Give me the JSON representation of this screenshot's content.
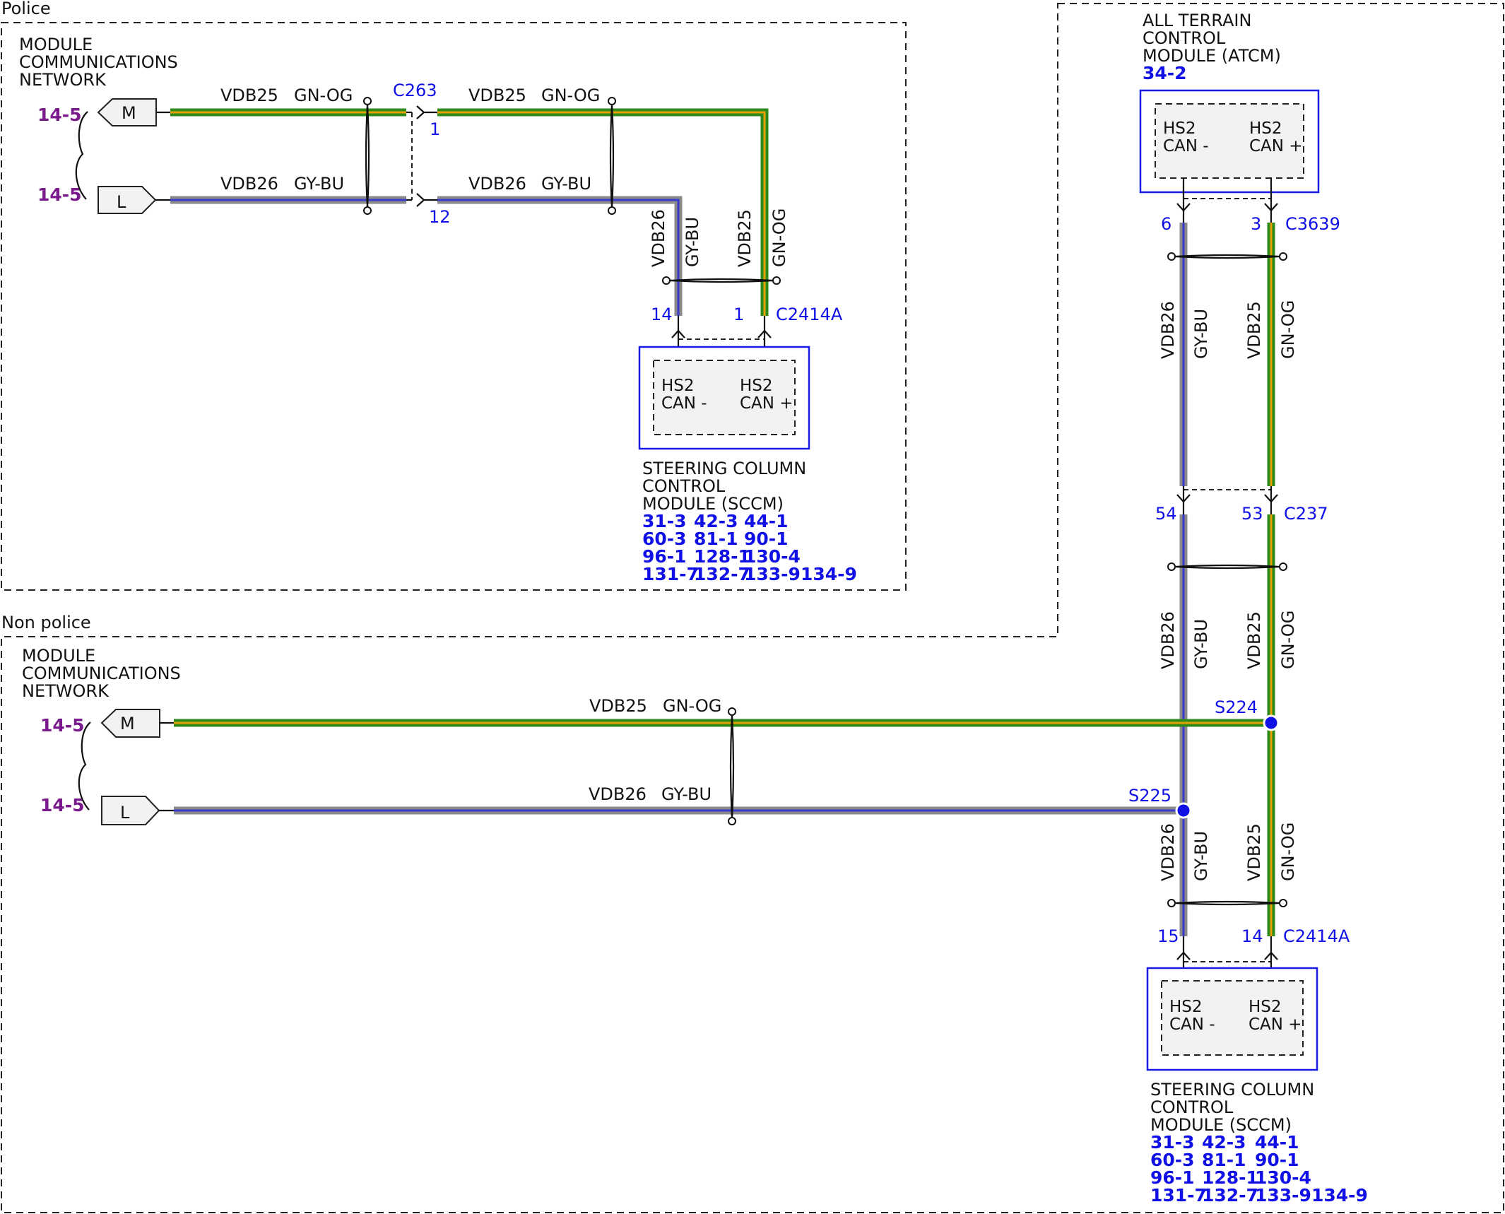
{
  "colors": {
    "gn_og_outer": "#2e8b1a",
    "gn_og_stripe": "#e5a100",
    "gy_bu_outer": "#8a8a8a",
    "gy_bu_stripe": "#3a3acd",
    "pin_blue": "#1010e6",
    "page_ref_purple": "#7a1a8c"
  },
  "police": {
    "frame_label": "Police",
    "network_title": [
      "MODULE",
      "COMMUNICATIONS",
      "NETWORK"
    ],
    "page_ref_m": "14-5",
    "page_ref_l": "14-5",
    "flag_m": "M",
    "flag_l": "L",
    "wire_upper_left": {
      "circuit": "VDB25",
      "color": "GN-OG"
    },
    "wire_lower_left": {
      "circuit": "VDB26",
      "color": "GY-BU"
    },
    "connector_c263": "C263",
    "c263_pin_upper": "1",
    "c263_pin_lower": "12",
    "wire_upper_right": {
      "circuit": "VDB25",
      "color": "GN-OG"
    },
    "wire_lower_right": {
      "circuit": "VDB26",
      "color": "GY-BU"
    },
    "vert_left": {
      "circuit": "VDB26",
      "color": "GY-BU"
    },
    "vert_right": {
      "circuit": "VDB25",
      "color": "GN-OG"
    },
    "sccm_pin_minus": "14",
    "sccm_pin_plus": "1",
    "sccm_connector": "C2414A",
    "sccm_inner_minus": [
      "HS2",
      "CAN -"
    ],
    "sccm_inner_plus": [
      "HS2",
      "CAN +"
    ],
    "sccm_name": [
      "STEERING COLUMN",
      "CONTROL",
      "MODULE (SCCM)"
    ],
    "sccm_refs": [
      [
        "31-3",
        "42-3",
        "44-1"
      ],
      [
        "60-3",
        "81-1",
        "90-1"
      ],
      [
        "96-1",
        "128-1",
        "130-4"
      ],
      [
        "131-7",
        "132-7",
        "133-9134-9"
      ]
    ]
  },
  "atcm": {
    "name": [
      "ALL TERRAIN",
      "CONTROL",
      "MODULE (ATCM)"
    ],
    "ref": "34-2",
    "inner_minus": [
      "HS2",
      "CAN -"
    ],
    "inner_plus": [
      "HS2",
      "CAN +"
    ],
    "pin_minus": "6",
    "pin_plus": "3",
    "connector": "C3639",
    "vert_left": {
      "circuit": "VDB26",
      "color": "GY-BU"
    },
    "vert_right": {
      "circuit": "VDB25",
      "color": "GN-OG"
    },
    "c237_pin_minus": "54",
    "c237_pin_plus": "53",
    "c237": "C237",
    "vert2_left": {
      "circuit": "VDB26",
      "color": "GY-BU"
    },
    "vert2_right": {
      "circuit": "VDB25",
      "color": "GN-OG"
    }
  },
  "nonpolice": {
    "frame_label": "Non police",
    "network_title": [
      "MODULE",
      "COMMUNICATIONS",
      "NETWORK"
    ],
    "page_ref_m": "14-5",
    "page_ref_l": "14-5",
    "flag_m": "M",
    "flag_l": "L",
    "wire_upper": {
      "circuit": "VDB25",
      "color": "GN-OG"
    },
    "wire_lower": {
      "circuit": "VDB26",
      "color": "GY-BU"
    },
    "splice_plus": "S224",
    "splice_minus": "S225",
    "vert_left": {
      "circuit": "VDB26",
      "color": "GY-BU"
    },
    "vert_right": {
      "circuit": "VDB25",
      "color": "GN-OG"
    },
    "sccm_pin_minus": "15",
    "sccm_pin_plus": "14",
    "sccm_connector": "C2414A",
    "sccm_inner_minus": [
      "HS2",
      "CAN -"
    ],
    "sccm_inner_plus": [
      "HS2",
      "CAN +"
    ],
    "sccm_name": [
      "STEERING COLUMN",
      "CONTROL",
      "MODULE (SCCM)"
    ],
    "sccm_refs": [
      [
        "31-3",
        "42-3",
        "44-1"
      ],
      [
        "60-3",
        "81-1",
        "90-1"
      ],
      [
        "96-1",
        "128-1",
        "130-4"
      ],
      [
        "131-7",
        "132-7",
        "133-9134-9"
      ]
    ]
  }
}
